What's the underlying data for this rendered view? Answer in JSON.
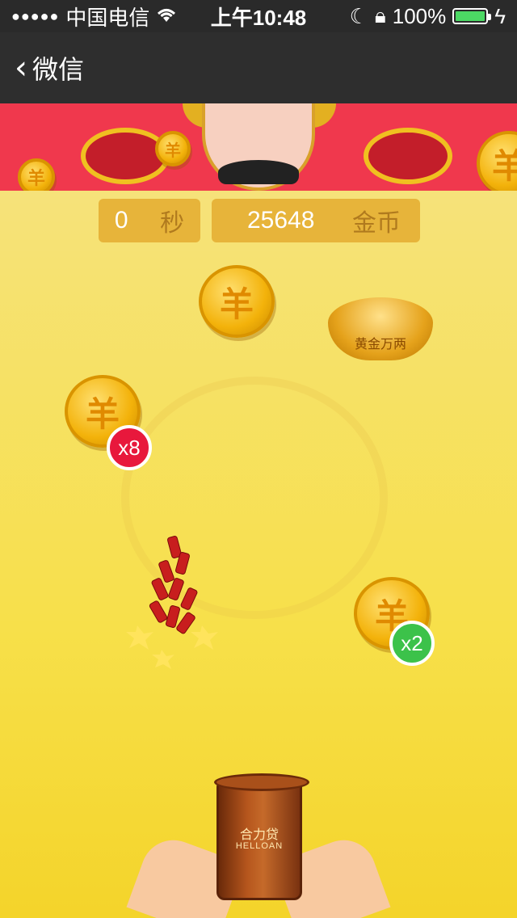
{
  "status_bar": {
    "signal": "●●●●●",
    "carrier": "中国电信",
    "time": "上午10:48",
    "battery_percent": "100%",
    "battery_level": 1.0
  },
  "nav": {
    "back_label": "微信"
  },
  "game": {
    "time_value": "0",
    "time_unit": "秒",
    "coin_value": "25648",
    "coin_unit": "金币",
    "coin_glyph": "羊",
    "multipliers": [
      {
        "label": "x8",
        "color": "#e8183c"
      },
      {
        "label": "x2",
        "color": "#3cc24a"
      }
    ],
    "ingot_text": "黄金万两",
    "bucket_brand_cn": "合力贷",
    "bucket_brand_en": "HELLOAN"
  },
  "colors": {
    "banner_red": "#f0384d",
    "scoreboard": "#e7b43a"
  }
}
